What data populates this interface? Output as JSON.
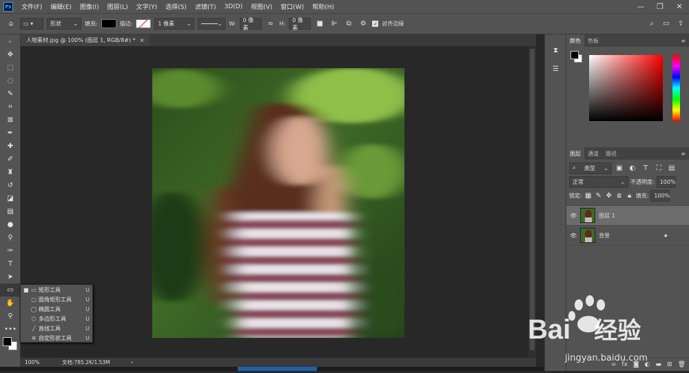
{
  "menu": {
    "logo": "Ps",
    "items": [
      "文件(F)",
      "编辑(E)",
      "图像(I)",
      "图层(L)",
      "文字(Y)",
      "选择(S)",
      "滤镜(T)",
      "3D(D)",
      "视图(V)",
      "窗口(W)",
      "帮助(H)"
    ]
  },
  "window_controls": [
    "—",
    "❐",
    "✕"
  ],
  "options": {
    "mode": "形状",
    "fill_label": "填充:",
    "stroke_label": "描边:",
    "stroke_width": "1 像素",
    "w_label": "W:",
    "w_value": "0 像素",
    "h_label": "H:",
    "h_value": "0 像素",
    "align_edges_label": "对齐边缘"
  },
  "document": {
    "tab_title": "人物素材.jpg @ 100% (图层 1, RGB/8#) *",
    "close": "×"
  },
  "status": {
    "zoom": "100%",
    "doc_info": "文档:785.2K/1.53M",
    "arrow": "›"
  },
  "flyout": {
    "items": [
      {
        "name": "矩形工具",
        "key": "U",
        "glyph": "▭",
        "active": true
      },
      {
        "name": "圆角矩形工具",
        "key": "U",
        "glyph": "▢",
        "active": false
      },
      {
        "name": "椭圆工具",
        "key": "U",
        "glyph": "◯",
        "active": false
      },
      {
        "name": "多边形工具",
        "key": "U",
        "glyph": "⬡",
        "active": false
      },
      {
        "name": "直线工具",
        "key": "U",
        "glyph": "╱",
        "active": false
      },
      {
        "name": "自定形状工具",
        "key": "U",
        "glyph": "✲",
        "active": false
      }
    ]
  },
  "color_panel": {
    "tabs": [
      "颜色",
      "色板"
    ],
    "foreground": "#000000",
    "background": "#ffffff",
    "hue": "#ff0000"
  },
  "layers_panel": {
    "tabs": [
      "图层",
      "通道",
      "路径"
    ],
    "filter_kind": "类型",
    "blend_mode": "正常",
    "opacity_label": "不透明度:",
    "opacity_value": "100%",
    "lock_label": "锁定:",
    "fill_label": "填充:",
    "fill_value": "100%",
    "layers": [
      {
        "name": "图层 1",
        "selected": true,
        "locked": false
      },
      {
        "name": "背景",
        "selected": false,
        "locked": true
      }
    ]
  },
  "watermark": {
    "brand": "Bai",
    "brand2": "经验",
    "url": "jingyan.baidu.com"
  },
  "colors": {
    "ui_bg": "#535353",
    "canvas_bg": "#282828",
    "accent": "#2fa3ff"
  }
}
